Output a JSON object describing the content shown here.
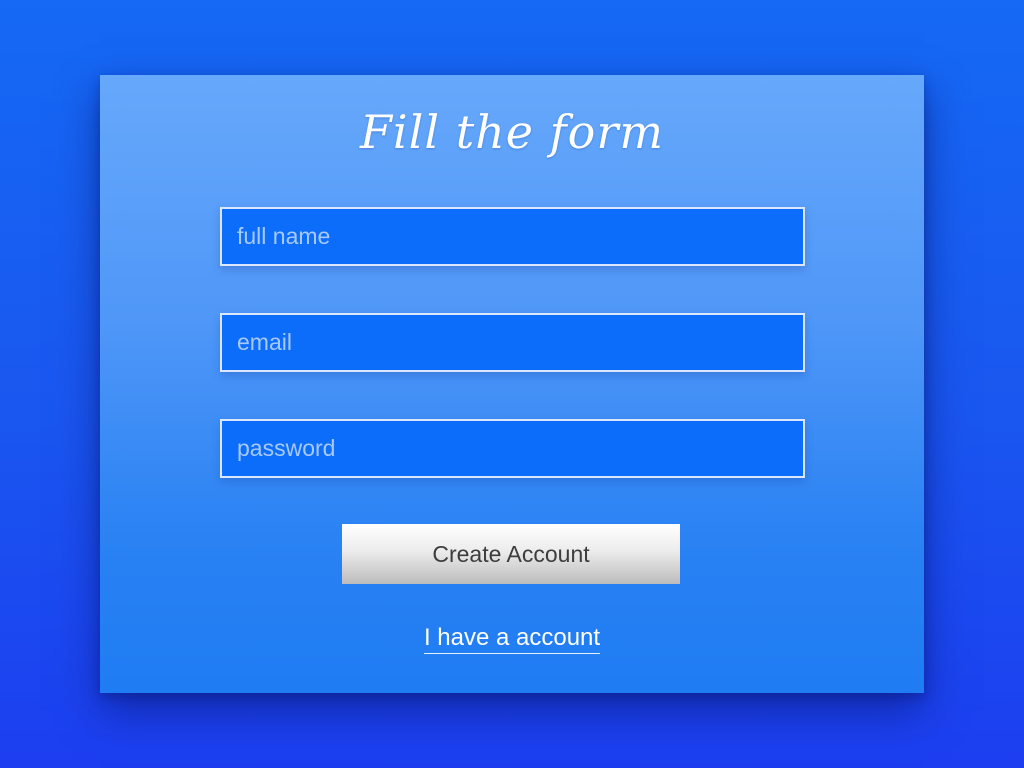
{
  "form": {
    "title": "Fill the form",
    "fields": [
      {
        "placeholder": "full name",
        "value": ""
      },
      {
        "placeholder": "email",
        "value": ""
      },
      {
        "placeholder": "password",
        "value": ""
      }
    ],
    "submit_label": "Create Account",
    "login_link_label": "I have a account"
  },
  "colors": {
    "background": "#1a56f0",
    "card_top": "#66a8fb",
    "card_bottom": "#1f7cf3",
    "field_fill": "#0b6df9",
    "field_border": "#dbe7ff",
    "button_text": "#3d3d3d"
  }
}
